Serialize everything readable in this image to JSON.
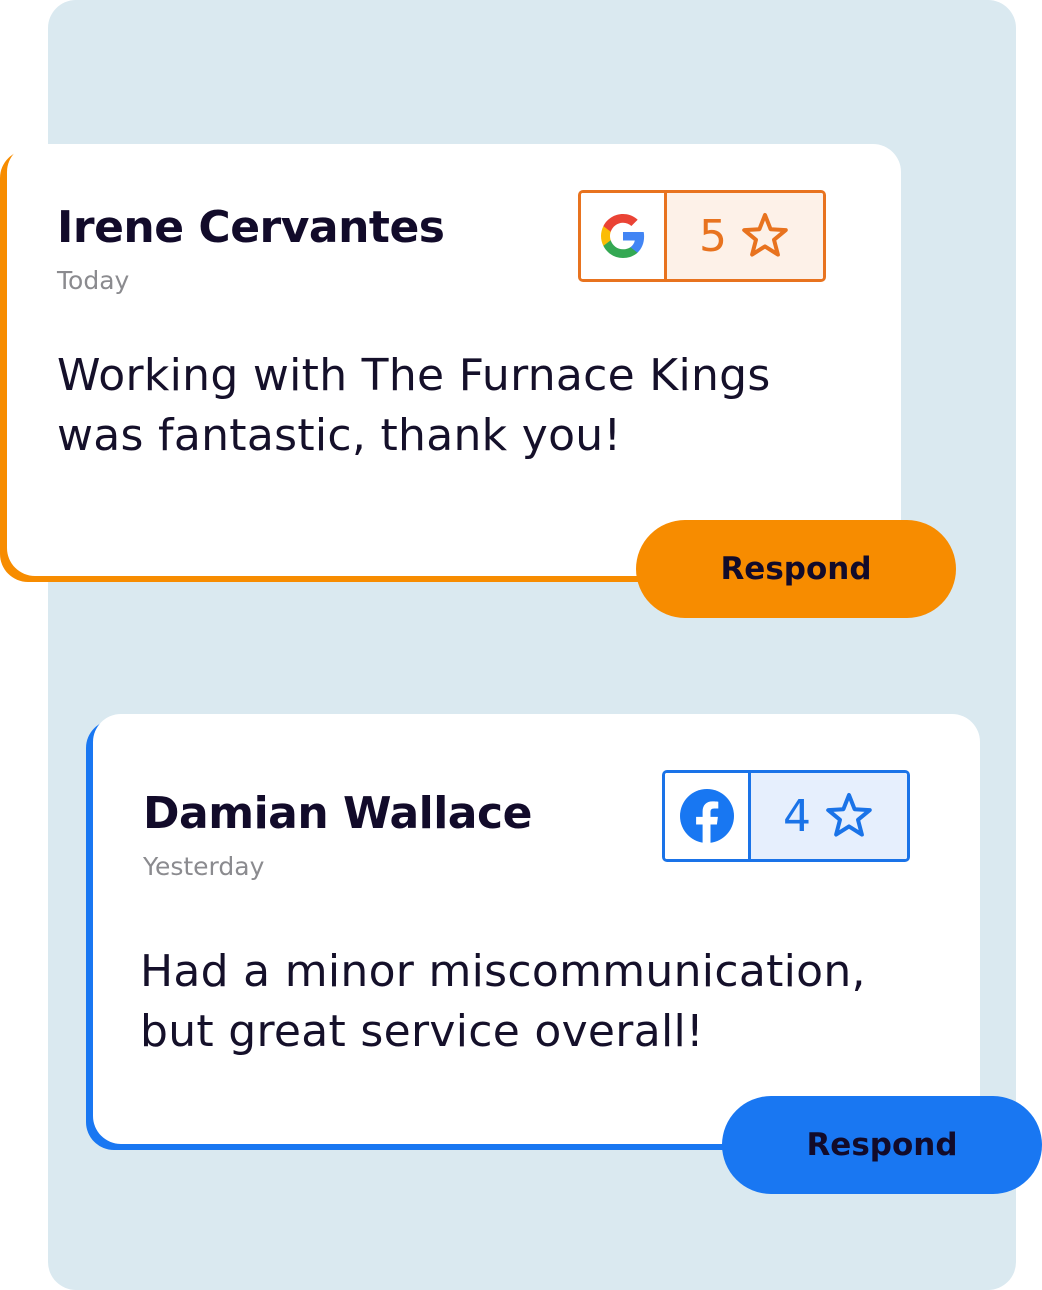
{
  "reviews": [
    {
      "name": "Irene Cervantes",
      "date": "Today",
      "text_line1": "Working with The Furnace Kings",
      "text_line2": "was fantastic, thank you!",
      "source_icon": "google-icon",
      "rating": "5",
      "rating_icon": "star-outline-icon",
      "accent_color": "#f78c00",
      "respond_label": "Respond"
    },
    {
      "name": "Damian Wallace",
      "date": "Yesterday",
      "text_line1": "Had a minor miscommunication,",
      "text_line2": "but great service overall!",
      "source_icon": "facebook-icon",
      "rating": "4",
      "rating_icon": "star-outline-icon",
      "accent_color": "#1977f2",
      "respond_label": "Respond"
    }
  ]
}
